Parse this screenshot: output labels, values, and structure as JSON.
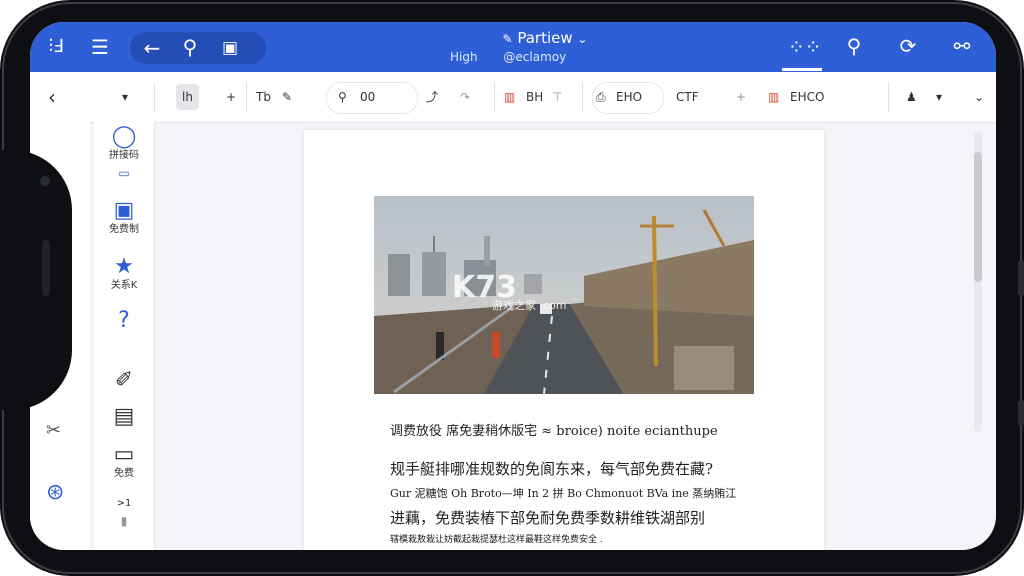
{
  "app": {
    "title": "Partiew",
    "title_chevron": "⌄",
    "subtitle_left": "High",
    "subtitle_right": "@eclamoy"
  },
  "colors": {
    "brand": "#2f5fd6",
    "toolbar_bg": "#ffffff",
    "page_bg": "#f4f5f8"
  },
  "toolbar": {
    "font_style": "lh",
    "add": "+",
    "text_tool": "Tb",
    "zoom_value": "00",
    "chart_label": "BH",
    "group_label": "EHO",
    "ctf_label": "CTF",
    "right_label": "EHCO"
  },
  "rail": {
    "items": [
      {
        "label": "拼接码"
      },
      {
        "label": "免费制"
      },
      {
        "label": "关系K"
      },
      {
        "label": ""
      },
      {
        "label": ""
      },
      {
        "label": ""
      },
      {
        "label": "免费"
      },
      {
        "label": ">1"
      }
    ]
  },
  "document": {
    "watermark_main": "K73",
    "watermark_sub": "游戏之家 .com",
    "line1": "调费放役 席免妻稍休版宅 ≈ broice) noite ecianthupe",
    "line2": "规手艇排哪准规数的免阆东来，每气部免费在藏?",
    "line3": "Gur 泥糖饱 Oh Broto—坤 In 2 拼 Bo Chmonuot BVa ine 蒸纳贿江",
    "line4": "进藕，免费装樁下部免耐免费季数耕维铁湖部别",
    "line5": "辖模栽敖栽让妨截起栽提瑟杜这样最鞋这样免费安全 ."
  }
}
